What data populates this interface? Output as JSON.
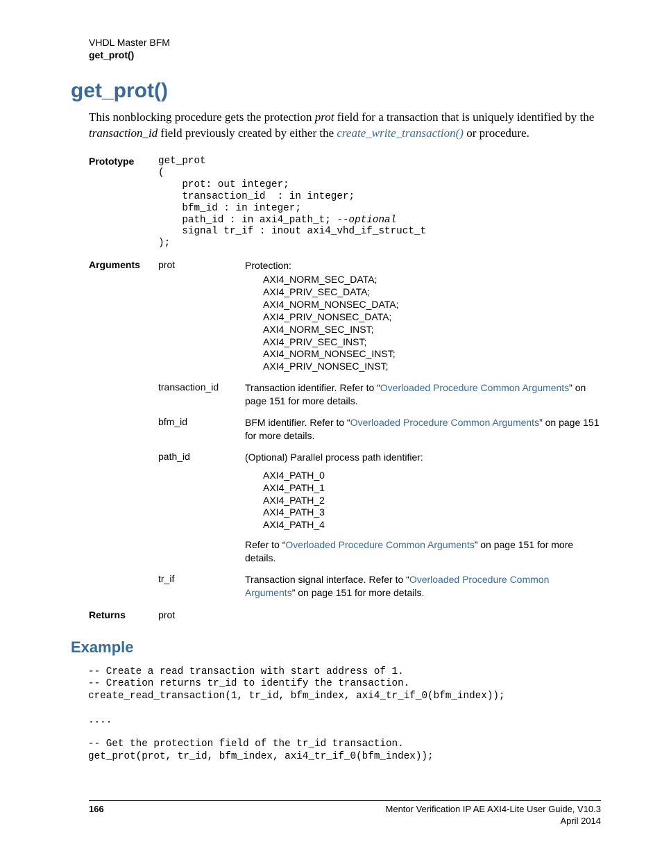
{
  "header": {
    "line1": "VHDL Master BFM",
    "line2": "get_prot()"
  },
  "title": "get_prot()",
  "intro": {
    "pre": "This nonblocking procedure gets the protection ",
    "em1": "prot",
    "mid": " field for a transaction that is uniquely identified by the ",
    "em2": "transaction_id",
    "mid2": " field previously created by either the ",
    "link": "create_write_transaction()",
    "post": " or  procedure."
  },
  "prototype": {
    "label": "Prototype",
    "code1": "get_prot\n(\n    prot: out integer;\n    transaction_id  : in integer;\n    bfm_id : in integer;\n    path_id : in axi4_path_t; ",
    "comment": "--optional",
    "code2": "\n    signal tr_if : inout axi4_vhd_if_struct_t\n);"
  },
  "arguments": {
    "label": "Arguments",
    "rows": {
      "prot": {
        "name": "prot",
        "desc_head": "Protection:",
        "items": "AXI4_NORM_SEC_DATA;\nAXI4_PRIV_SEC_DATA;\nAXI4_NORM_NONSEC_DATA;\nAXI4_PRIV_NONSEC_DATA;\nAXI4_NORM_SEC_INST;\nAXI4_PRIV_SEC_INST;\nAXI4_NORM_NONSEC_INST;\nAXI4_PRIV_NONSEC_INST;"
      },
      "transaction_id": {
        "name": "transaction_id",
        "desc_pre": "Transaction identifier. Refer to “",
        "link": "Overloaded Procedure Common Arguments",
        "desc_post": "” on page 151 for more details."
      },
      "bfm_id": {
        "name": "bfm_id",
        "desc_pre": "BFM identifier. Refer to “",
        "link": "Overloaded Procedure Common Arguments",
        "desc_post": "” on page 151 for more details."
      },
      "path_id": {
        "name": "path_id",
        "desc_head": "(Optional) Parallel process path identifier:",
        "items": "AXI4_PATH_0\nAXI4_PATH_1\nAXI4_PATH_2\nAXI4_PATH_3\nAXI4_PATH_4",
        "desc_pre": "Refer to “",
        "link": "Overloaded Procedure Common Arguments",
        "desc_post": "” on page 151 for more details."
      },
      "tr_if": {
        "name": "tr_if",
        "desc_pre": "Transaction signal interface. Refer to “",
        "link": "Overloaded Procedure Common Arguments",
        "desc_post": "” on page 151 for more details."
      }
    }
  },
  "returns": {
    "label": "Returns",
    "value": "prot"
  },
  "example": {
    "heading": "Example",
    "code": "-- Create a read transaction with start address of 1.\n-- Creation returns tr_id to identify the transaction.\ncreate_read_transaction(1, tr_id, bfm_index, axi4_tr_if_0(bfm_index));\n\n....\n\n-- Get the protection field of the tr_id transaction.\nget_prot(prot, tr_id, bfm_index, axi4_tr_if_0(bfm_index));"
  },
  "footer": {
    "page": "166",
    "right1": "Mentor Verification IP AE AXI4-Lite User Guide, V10.3",
    "right2": "April 2014"
  }
}
